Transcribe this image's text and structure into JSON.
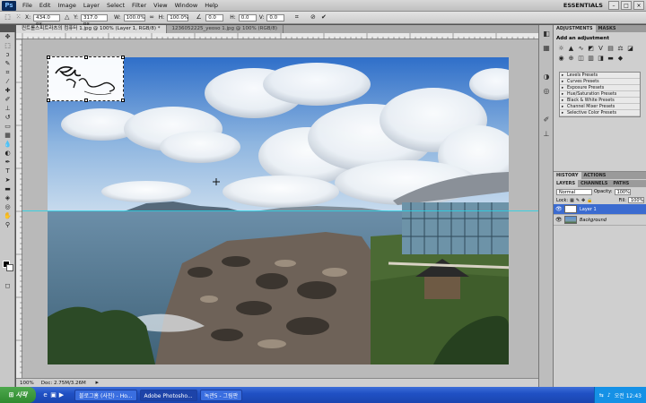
{
  "menubar": {
    "logo": "Ps",
    "items": [
      "File",
      "Edit",
      "Image",
      "Layer",
      "Select",
      "Filter",
      "View",
      "Window",
      "Help"
    ],
    "workspace": "ESSENTIALS"
  },
  "options": {
    "x_label": "X:",
    "x_value": "434.0 px",
    "y_label": "Y:",
    "y_value": "317.0 px",
    "w_label": "W:",
    "w_value": "100.0%",
    "h_label": "H:",
    "h_value": "100.0%",
    "angle_value": "0.0",
    "hskew_label": "H:",
    "hskew_value": "0.0",
    "vskew_label": "V:",
    "vskew_value": "0.0"
  },
  "tabs": [
    {
      "label": "컨트롤스피트라츠의 컴퓨터 1.jpg @ 100% (Layer 1, RGB/8) *",
      "active": true
    },
    {
      "label": "1236052225_yeoso 1.jpg @ 100% (RGB/8)",
      "active": false
    }
  ],
  "status": {
    "zoom": "100%",
    "doc": "Doc: 2.75M/3.26M"
  },
  "panels": {
    "top_tabs": [
      "ADJUSTMENTS",
      "MASKS"
    ],
    "adj_title": "Add an adjustment",
    "presets": [
      "Levels Presets",
      "Curves Presets",
      "Exposure Presets",
      "Hue/Saturation Presets",
      "Black & White Presets",
      "Channel Mixer Presets",
      "Selective Color Presets"
    ],
    "history_tabs": [
      "HISTORY",
      "ACTIONS"
    ],
    "layer_tabs": [
      "LAYERS",
      "CHANNELS",
      "PATHS"
    ],
    "blend_mode": "Normal",
    "opacity_label": "Opacity:",
    "opacity_value": "100%",
    "lock_label": "Lock:",
    "fill_label": "Fill:",
    "fill_value": "100%",
    "layers": [
      {
        "name": "Layer 1",
        "active": true
      },
      {
        "name": "Background",
        "active": false
      }
    ]
  },
  "taskbar": {
    "start": "시작",
    "tasks": [
      {
        "label": "블로그홈 (사진) - Ho...",
        "active": false
      },
      {
        "label": "Adobe Photosho...",
        "active": true
      },
      {
        "label": "녹관5 - 그림판",
        "active": false
      }
    ],
    "time": "오전 12:43"
  },
  "colors": {
    "accent_guide": "#27d3e6",
    "layer_selected": "#3b6bd0"
  }
}
